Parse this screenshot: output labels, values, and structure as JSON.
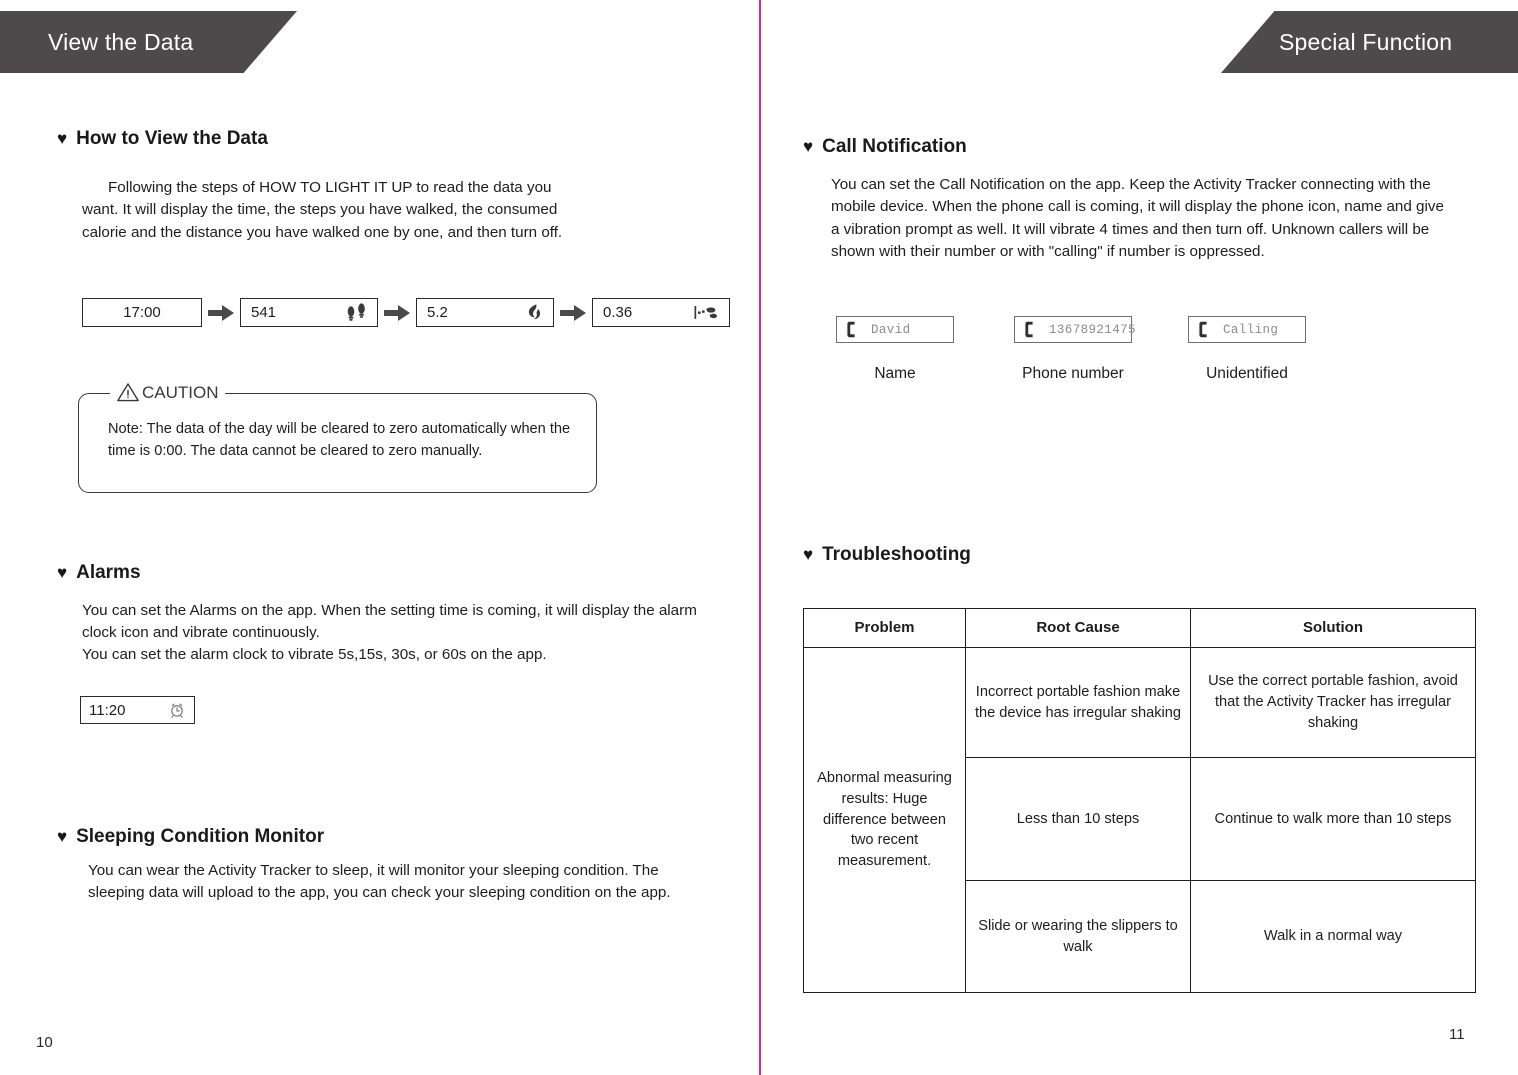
{
  "left_page": {
    "banner_title": "View the Data",
    "page_number": "10",
    "how_to_view": {
      "heading": "How to View the Data",
      "paragraph": "Following the steps of HOW TO LIGHT IT UP to read the data you want. It will display the time, the steps you have walked, the consumed calorie and the distance you have walked one by one, and then turn off.",
      "flow": [
        {
          "value": "17:00",
          "icon": "none"
        },
        {
          "value": "541",
          "icon": "footprints-icon"
        },
        {
          "value": "5.2",
          "icon": "flame-icon"
        },
        {
          "value": "0.36",
          "icon": "distance-icon"
        }
      ]
    },
    "caution": {
      "label": "CAUTION",
      "text": "Note: The data of the day will be cleared to zero automatically when the time is 0:00. The data cannot be cleared to zero manually."
    },
    "alarms": {
      "heading": "Alarms",
      "paragraph_line1": "You can set the Alarms on the app. When the setting time is coming, it will display the alarm clock icon and vibrate continuously.",
      "paragraph_line2": "You can set the alarm clock to vibrate 5s,15s, 30s, or 60s on the app.",
      "display_value": "11:20",
      "display_icon": "alarm-clock-icon"
    },
    "sleeping": {
      "heading": "Sleeping Condition Monitor",
      "paragraph": "You can wear the Activity Tracker to sleep, it will monitor your sleeping condition. The sleeping data will upload to the app, you can check your sleeping condition on the app."
    }
  },
  "right_page": {
    "banner_title": "Special Function",
    "page_number": "11",
    "call_notification": {
      "heading": "Call Notification",
      "paragraph": "You can set the Call Notification on the app. Keep the Activity Tracker connecting with the mobile device. When the phone call is coming, it will display the phone icon, name and give a vibration prompt as well. It will vibrate 4 times and then turn off. Unknown callers will be shown with their number or with \"calling\" if number is oppressed.",
      "samples": [
        {
          "display": "David",
          "caption": "Name"
        },
        {
          "display": "13678921475",
          "caption": "Phone number"
        },
        {
          "display": "Calling",
          "caption": "Unidentified"
        }
      ]
    },
    "troubleshooting": {
      "heading": "Troubleshooting",
      "columns": [
        "Problem",
        "Root Cause",
        "Solution"
      ],
      "problem": "Abnormal measuring results: Huge difference between two recent measurement.",
      "rows": [
        {
          "cause": "Incorrect portable fashion make the device has irregular shaking",
          "solution": "Use the correct portable fashion, avoid that the Activity Tracker has irregular shaking"
        },
        {
          "cause": "Less than 10 steps",
          "solution": "Continue to walk more than 10 steps"
        },
        {
          "cause": "Slide or wearing the slippers to walk",
          "solution": "Walk in a normal way"
        }
      ]
    }
  },
  "colors": {
    "banner": "#4d4a4b",
    "divider": "#e2258c",
    "text": "#1d1d1d"
  }
}
